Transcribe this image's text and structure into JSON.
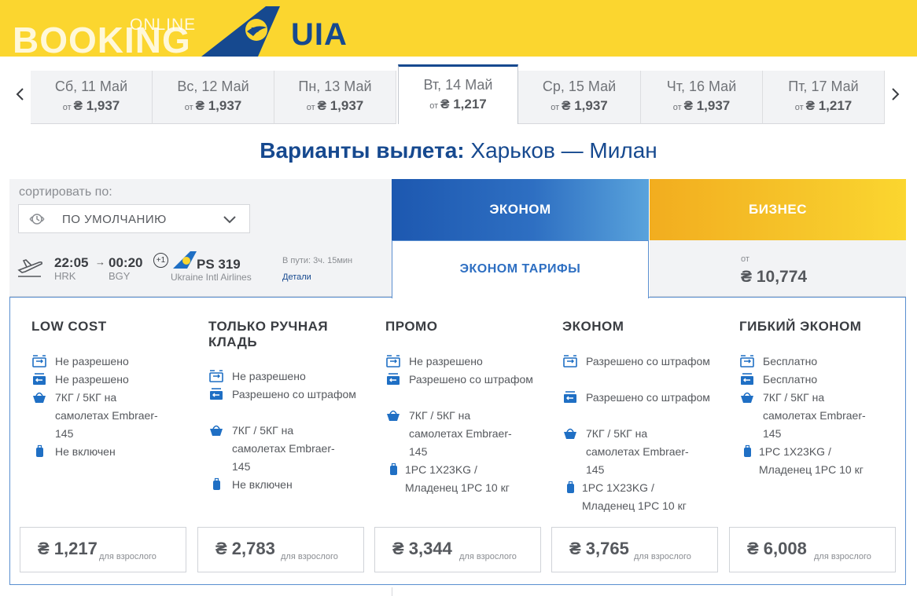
{
  "header": {
    "booking": "BOOKING",
    "online": "ONLINE",
    "brand": "UIA",
    "colors": {
      "header_bg": "#fbd62f",
      "brand_blue": "#16498f"
    }
  },
  "dates": [
    {
      "label": "Сб, 11 Май",
      "from": "от",
      "price": "₴ 1,937"
    },
    {
      "label": "Вс, 12 Май",
      "from": "от",
      "price": "₴ 1,937"
    },
    {
      "label": "Пн, 13 Май",
      "from": "от",
      "price": "₴ 1,937"
    },
    {
      "label": "Вт, 14 Май",
      "from": "от",
      "price": "₴ 1,217",
      "active": true
    },
    {
      "label": "Ср, 15 Май",
      "from": "от",
      "price": "₴ 1,937"
    },
    {
      "label": "Чт, 16 Май",
      "from": "от",
      "price": "₴ 1,937"
    },
    {
      "label": "Пт, 17 Май",
      "from": "от",
      "price": "₴ 1,217"
    }
  ],
  "title": {
    "prefix": "Варианты вылета:",
    "route": "Харьков — Милан"
  },
  "sort": {
    "label": "сортировать по:",
    "value": "ПО УМОЛЧАНИЮ"
  },
  "classes": {
    "economy": "ЭКОНОМ",
    "business": "БИЗНЕС"
  },
  "flight": {
    "dep_time": "22:05",
    "arr_time": "00:20",
    "plus_day": "+1",
    "dep_code": "HRK",
    "arr_code": "BGY",
    "flight_no": "PS 319",
    "airline": "Ukraine Intl Airlines",
    "duration": "В пути: 3ч. 15мин",
    "details": "Детали"
  },
  "tariff_tab": "ЭКОНОМ ТАРИФЫ",
  "business_price": {
    "from": "от",
    "price": "₴ 10,774"
  },
  "fares": [
    {
      "name": "LOW COST",
      "features": [
        {
          "icon": "ticket-change-icon",
          "text": "Не разрешено"
        },
        {
          "icon": "ticket-refund-icon",
          "text": "Не разрешено"
        },
        {
          "icon": "hand-bag-icon",
          "text": "7КГ / 5КГ на самолетах Embraer-145"
        },
        {
          "icon": "suitcase-icon",
          "text": "Не включен"
        }
      ],
      "price": "₴ 1,217",
      "price_note": "для взрослого"
    },
    {
      "name": "ТОЛЬКО РУЧНАЯ КЛАДЬ",
      "features": [
        {
          "icon": "ticket-change-icon",
          "text": "Не разрешено"
        },
        {
          "icon": "ticket-refund-icon",
          "text": "Разрешено со штрафом"
        },
        {
          "icon": "hand-bag-icon",
          "text": "7КГ / 5КГ на самолетах Embraer-145"
        },
        {
          "icon": "suitcase-icon",
          "text": "Не включен"
        }
      ],
      "price": "₴ 2,783",
      "price_note": "для взрослого"
    },
    {
      "name": "ПРОМО",
      "features": [
        {
          "icon": "ticket-change-icon",
          "text": "Не разрешено"
        },
        {
          "icon": "ticket-refund-icon",
          "text": "Разрешено со штрафом"
        },
        {
          "icon": "hand-bag-icon",
          "text": "7КГ / 5КГ на самолетах Embraer-145"
        },
        {
          "icon": "suitcase-icon",
          "text": "1PC 1X23KG / Младенец 1PC 10 кг"
        }
      ],
      "price": "₴ 3,344",
      "price_note": "для взрослого"
    },
    {
      "name": "ЭКОНОМ",
      "features": [
        {
          "icon": "ticket-change-icon",
          "text": "Разрешено со штрафом"
        },
        {
          "icon": "ticket-refund-icon",
          "text": "Разрешено со штрафом"
        },
        {
          "icon": "hand-bag-icon",
          "text": "7КГ / 5КГ на самолетах Embraer-145"
        },
        {
          "icon": "suitcase-icon",
          "text": "1PC 1X23KG / Младенец 1PC 10 кг"
        }
      ],
      "price": "₴ 3,765",
      "price_note": "для взрослого"
    },
    {
      "name": "ГИБКИЙ ЭКОНОМ",
      "features": [
        {
          "icon": "ticket-change-icon",
          "text": "Бесплатно"
        },
        {
          "icon": "ticket-refund-icon",
          "text": "Бесплатно"
        },
        {
          "icon": "hand-bag-icon",
          "text": "7КГ / 5КГ на самолетах Embraer-145"
        },
        {
          "icon": "suitcase-icon",
          "text": "1PC 1X23KG / Младенец 1PC 10 кг"
        }
      ],
      "price": "₴ 6,008",
      "price_note": "для взрослого"
    }
  ]
}
